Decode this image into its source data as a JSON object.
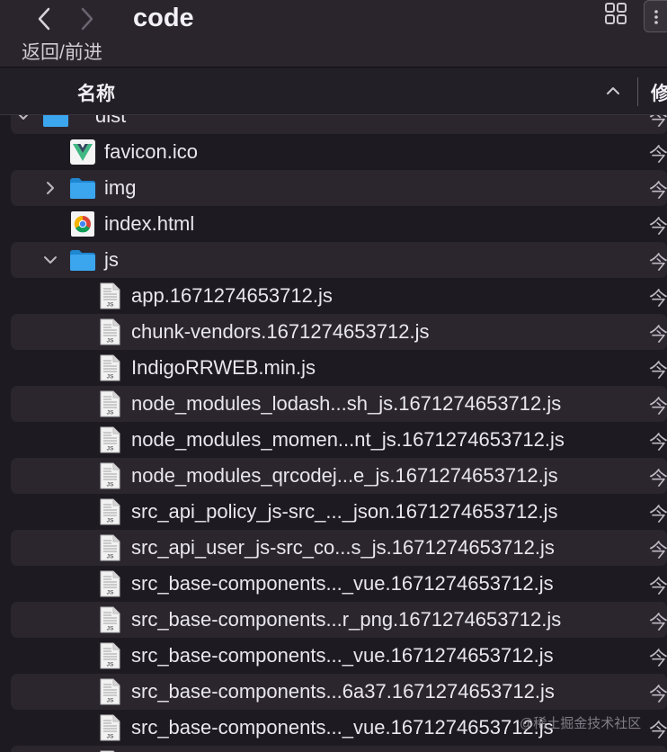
{
  "toolbar": {
    "title": "code",
    "nav_caption": "返回/前进",
    "back_icon": "chevron-left-icon",
    "forward_icon": "chevron-right-icon",
    "view_icon": "grid-view-icon",
    "more_icon": "more-icon"
  },
  "columns": {
    "name": "名称",
    "modified": "修",
    "sort_icon": "chevron-up-icon"
  },
  "rows": [
    {
      "label": "dist",
      "date": "今",
      "icon": "folder",
      "indent": 0,
      "disclosure": "expanded"
    },
    {
      "label": "favicon.ico",
      "date": "今",
      "icon": "vue-logo",
      "indent": 1,
      "disclosure": "none"
    },
    {
      "label": "img",
      "date": "今",
      "icon": "folder",
      "indent": 1,
      "disclosure": "collapsed"
    },
    {
      "label": "index.html",
      "date": "今",
      "icon": "chrome-logo",
      "indent": 1,
      "disclosure": "none"
    },
    {
      "label": "js",
      "date": "今",
      "icon": "folder",
      "indent": 1,
      "disclosure": "expanded"
    },
    {
      "label": "app.1671274653712.js",
      "date": "今",
      "icon": "js-file",
      "indent": 2,
      "disclosure": "none"
    },
    {
      "label": "chunk-vendors.1671274653712.js",
      "date": "今",
      "icon": "js-file",
      "indent": 2,
      "disclosure": "none"
    },
    {
      "label": "IndigoRRWEB.min.js",
      "date": "今",
      "icon": "js-file",
      "indent": 2,
      "disclosure": "none"
    },
    {
      "label": "node_modules_lodash...sh_js.1671274653712.js",
      "date": "今",
      "icon": "js-file",
      "indent": 2,
      "disclosure": "none"
    },
    {
      "label": "node_modules_momen...nt_js.1671274653712.js",
      "date": "今",
      "icon": "js-file",
      "indent": 2,
      "disclosure": "none"
    },
    {
      "label": "node_modules_qrcodej...e_js.1671274653712.js",
      "date": "今",
      "icon": "js-file",
      "indent": 2,
      "disclosure": "none"
    },
    {
      "label": "src_api_policy_js-src_..._json.1671274653712.js",
      "date": "今",
      "icon": "js-file",
      "indent": 2,
      "disclosure": "none"
    },
    {
      "label": "src_api_user_js-src_co...s_js.1671274653712.js",
      "date": "今",
      "icon": "js-file",
      "indent": 2,
      "disclosure": "none"
    },
    {
      "label": "src_base-components..._vue.1671274653712.js",
      "date": "今",
      "icon": "js-file",
      "indent": 2,
      "disclosure": "none"
    },
    {
      "label": "src_base-components...r_png.1671274653712.js",
      "date": "今",
      "icon": "js-file",
      "indent": 2,
      "disclosure": "none"
    },
    {
      "label": "src_base-components..._vue.1671274653712.js",
      "date": "今",
      "icon": "js-file",
      "indent": 2,
      "disclosure": "none"
    },
    {
      "label": "src_base-components...6a37.1671274653712.js",
      "date": "今",
      "icon": "js-file",
      "indent": 2,
      "disclosure": "none"
    },
    {
      "label": "src_base-components..._vue.1671274653712.js",
      "date": "今",
      "icon": "js-file",
      "indent": 2,
      "disclosure": "none"
    },
    {
      "label": "",
      "date": "",
      "icon": "js-file",
      "indent": 2,
      "disclosure": "none"
    }
  ],
  "watermark": "@稀土掘金技术社区",
  "colors": {
    "folder": "#3ba6ee",
    "row_alt": "#2b262e",
    "background": "#1e1a21"
  }
}
